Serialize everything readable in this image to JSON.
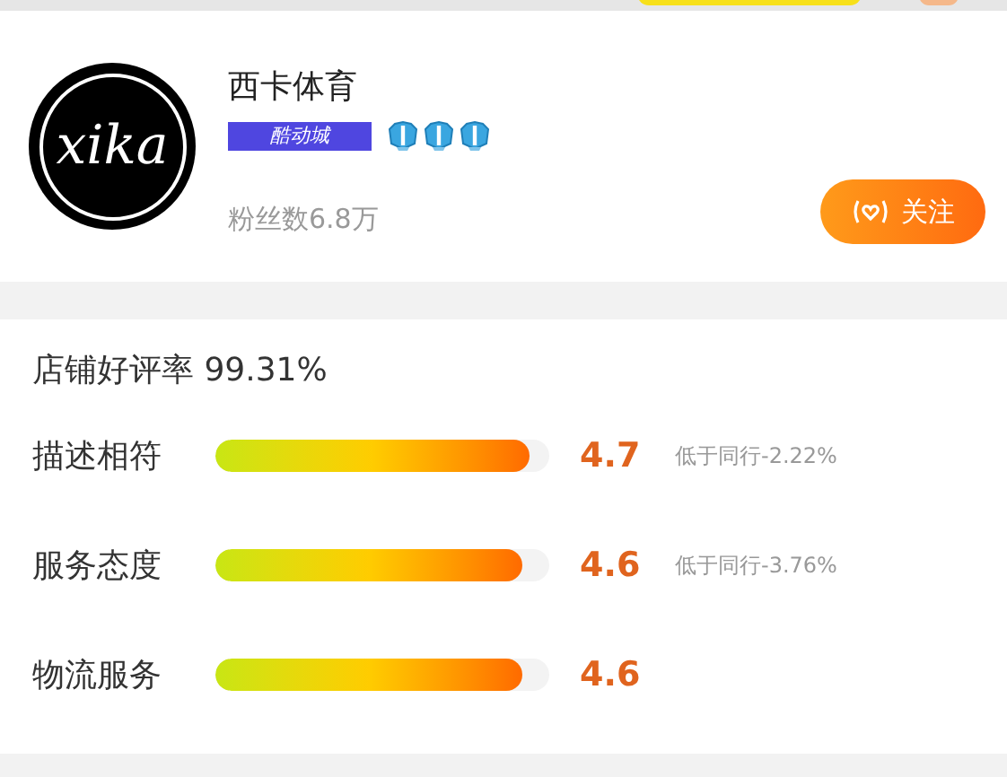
{
  "shop": {
    "logo_text": "xika",
    "name": "西卡体育",
    "badge": "酷动城",
    "crowns": [
      {
        "kind": "crown"
      },
      {
        "kind": "crown"
      },
      {
        "kind": "crown"
      }
    ],
    "fans": "粉丝数6.8万",
    "follow_button": "关注"
  },
  "rating": {
    "label": "店铺好评率 99.31%",
    "rows": [
      {
        "label": "描述相符",
        "level": 0.94,
        "score": "4.7",
        "comparison": "低于同行-2.22%"
      },
      {
        "label": "服务态度",
        "level": 0.92,
        "score": "4.6",
        "comparison": "低于同行-3.76%"
      },
      {
        "label": "物流服务",
        "level": 0.92,
        "score": "4.6"
      }
    ]
  }
}
